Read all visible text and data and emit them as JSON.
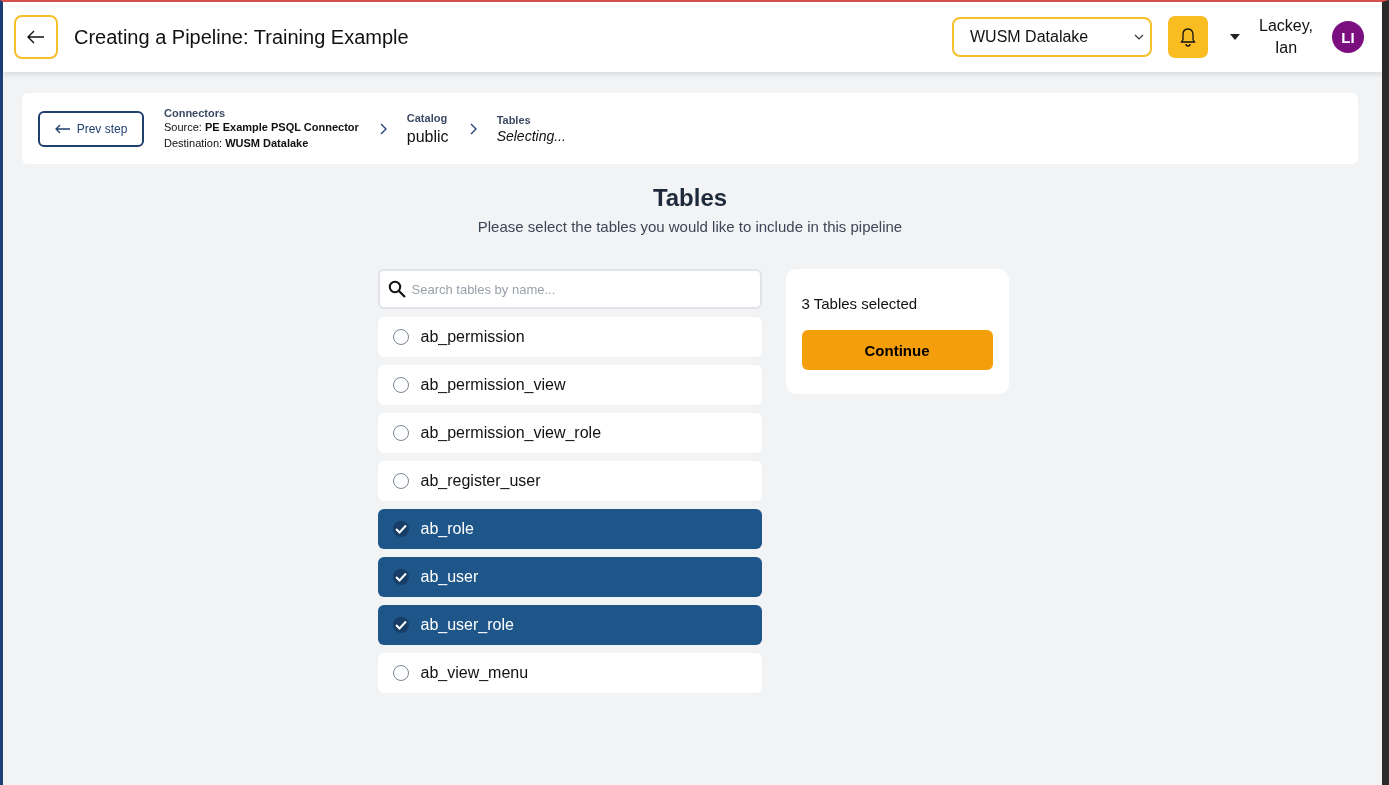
{
  "header": {
    "title": "Creating a Pipeline: Training Example",
    "datalake_select": {
      "value": "WUSM Datalake"
    },
    "user": {
      "name": "Lackey, Ian",
      "initials": "LI"
    }
  },
  "breadcrumb": {
    "prev_button": "Prev step",
    "steps": [
      {
        "label": "Connectors",
        "lines": [
          "Source: **PE Example PSQL Connector**",
          "Destination: **WUSM Datalake**"
        ],
        "kind": "details"
      },
      {
        "label": "Catalog",
        "value": "public",
        "kind": "value"
      },
      {
        "label": "Tables",
        "value": "Selecting...",
        "kind": "pending"
      }
    ]
  },
  "section": {
    "title": "Tables",
    "subtitle": "Please select the tables you would like to include in this pipeline"
  },
  "search": {
    "placeholder": "Search tables by name..."
  },
  "tables": [
    {
      "name": "ab_permission",
      "selected": false
    },
    {
      "name": "ab_permission_view",
      "selected": false
    },
    {
      "name": "ab_permission_view_role",
      "selected": false
    },
    {
      "name": "ab_register_user",
      "selected": false
    },
    {
      "name": "ab_role",
      "selected": true
    },
    {
      "name": "ab_user",
      "selected": true
    },
    {
      "name": "ab_user_role",
      "selected": true
    },
    {
      "name": "ab_view_menu",
      "selected": false
    }
  ],
  "summary": {
    "count_text": "3 Tables selected",
    "button": "Continue"
  }
}
